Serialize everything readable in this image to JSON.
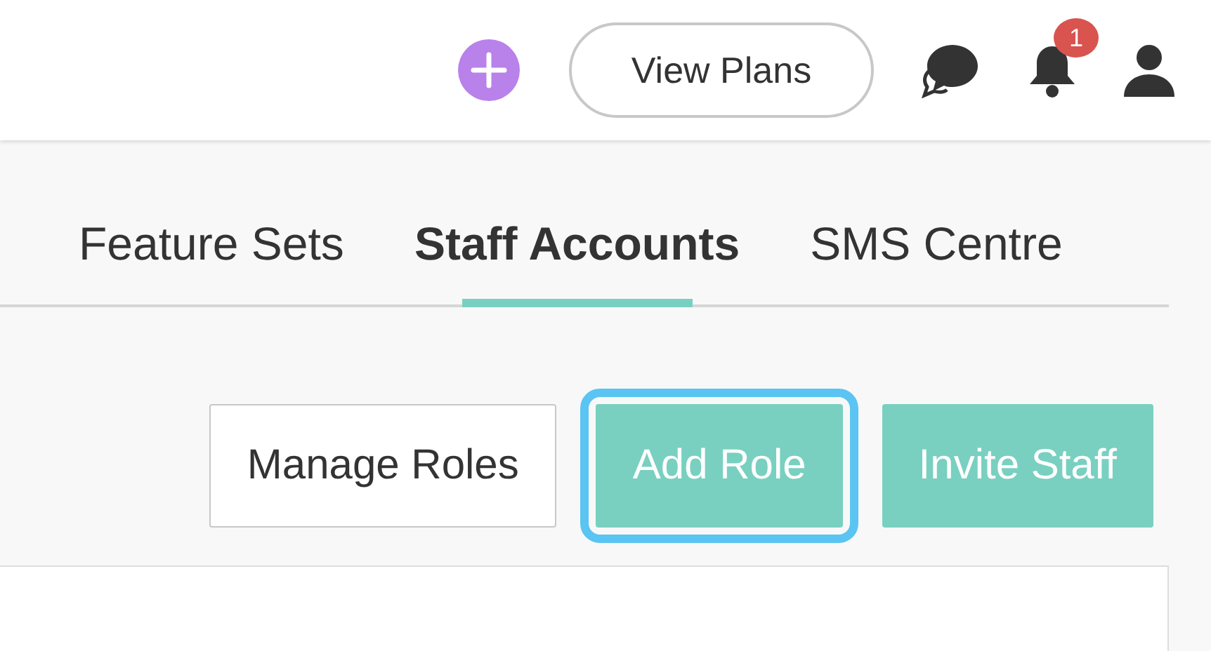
{
  "header": {
    "view_plans": "View Plans",
    "notifications_badge": "1"
  },
  "tabs": [
    {
      "label": "Feature Sets",
      "selected": false
    },
    {
      "label": "Staff Accounts",
      "selected": true
    },
    {
      "label": "SMS Centre",
      "selected": false
    }
  ],
  "actions": [
    {
      "label": "Manage Roles",
      "kind": "outline",
      "focused": false
    },
    {
      "label": "Add Role",
      "kind": "primary",
      "focused": true
    },
    {
      "label": "Invite Staff",
      "kind": "primary",
      "focused": false
    }
  ]
}
